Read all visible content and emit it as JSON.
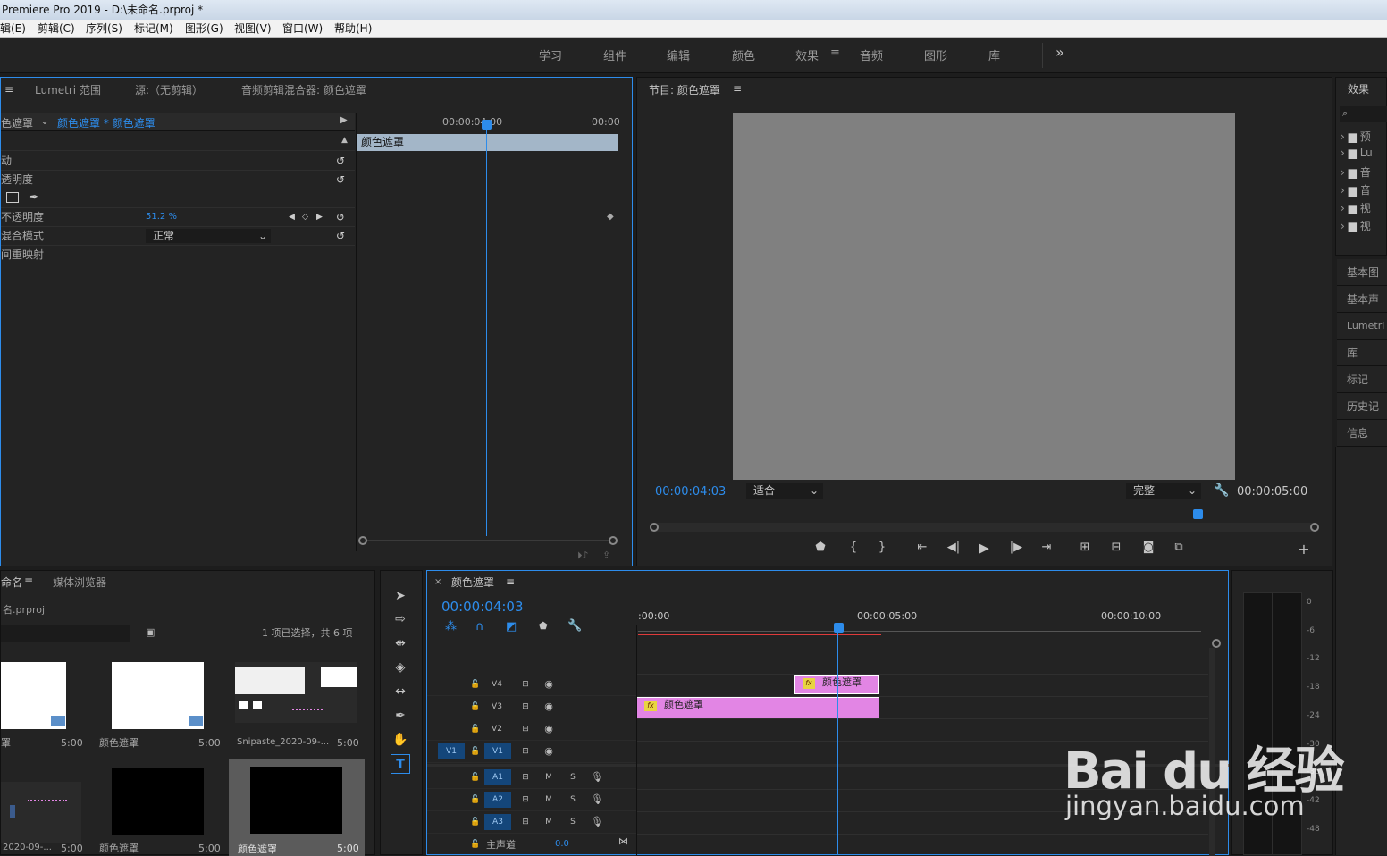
{
  "window": {
    "title": "Premiere Pro 2019 - D:\\未命名.prproj *"
  },
  "menu": [
    "辑(E)",
    "剪辑(C)",
    "序列(S)",
    "标记(M)",
    "图形(G)",
    "视图(V)",
    "窗口(W)",
    "帮助(H)"
  ],
  "workspaces": [
    {
      "label": "学习",
      "active": false
    },
    {
      "label": "组件",
      "active": false
    },
    {
      "label": "编辑",
      "active": false
    },
    {
      "label": "颜色",
      "active": false
    },
    {
      "label": "效果",
      "active": true
    },
    {
      "label": "音频",
      "active": false
    },
    {
      "label": "图形",
      "active": false
    },
    {
      "label": "库",
      "active": false
    }
  ],
  "workspace_more": "»",
  "source_panel": {
    "tabs": [
      "Lumetri 范围",
      "源:（无剪辑）",
      "音频剪辑混合器: 颜色遮罩"
    ],
    "clip_master": "色遮罩",
    "clip_instance": "颜色遮罩 * 颜色遮罩",
    "ruler_start": "00:00:04:00",
    "ruler_end": "00:00",
    "mini_clip_label": "颜色遮罩",
    "props": [
      {
        "label": "动"
      },
      {
        "label": "透明度"
      },
      {
        "label": ""
      },
      {
        "label": "不透明度",
        "value": "51.2 %"
      },
      {
        "label": "混合模式",
        "value": "正常"
      },
      {
        "label": "间重映射"
      }
    ]
  },
  "program_monitor": {
    "title": "节目: 颜色遮罩",
    "timecode": "00:00:04:03",
    "fit": "适合",
    "quality": "完整",
    "duration": "00:00:05:00",
    "preview_color": "#808080"
  },
  "effects_panel": {
    "title": "效果",
    "items": [
      "预",
      "Lu",
      "音",
      "音",
      "视",
      "视"
    ],
    "side_tabs": [
      "基本图形",
      "基本声音",
      "Lumetri 颜色",
      "库",
      "标记",
      "历史记录",
      "信息"
    ]
  },
  "project_panel": {
    "tab": "命名",
    "tab2": "媒体浏览器",
    "file": "名.prproj",
    "selection_info": "1 项已选择，共 6 项",
    "items": [
      {
        "label": "罩",
        "duration": "5:00"
      },
      {
        "label": "颜色遮罩",
        "duration": "5:00"
      },
      {
        "label": "Snipaste_2020-09-...",
        "duration": "5:00"
      },
      {
        "label": "2020-09-...",
        "duration": "5:00"
      },
      {
        "label": "颜色遮罩",
        "duration": "5:00"
      },
      {
        "label": "颜色遮罩",
        "duration": "5:00"
      }
    ]
  },
  "timeline": {
    "title": "颜色遮罩",
    "timecode": "00:00:04:03",
    "ruler": [
      ":00:00",
      "00:00:05:00",
      "00:00:10:00"
    ],
    "video_tracks": [
      "V4",
      "V3",
      "V2",
      "V1"
    ],
    "audio_tracks": [
      "A1",
      "A2",
      "A3"
    ],
    "source_patch": "V1",
    "master_label": "主声道",
    "master_value": "0.0",
    "mute": "M",
    "solo": "S",
    "clips": [
      {
        "track": "V4",
        "label": "颜色遮罩"
      },
      {
        "track": "V3",
        "label": "颜色遮罩"
      }
    ],
    "clip_color": "#e285e4"
  },
  "audio_meter": {
    "ticks": [
      "0",
      "-6",
      "-12",
      "-18",
      "-24",
      "-30",
      "-36",
      "-42",
      "-48"
    ]
  },
  "watermark": {
    "brand": "Bai du 经验",
    "url": "jingyan.baidu.com"
  }
}
